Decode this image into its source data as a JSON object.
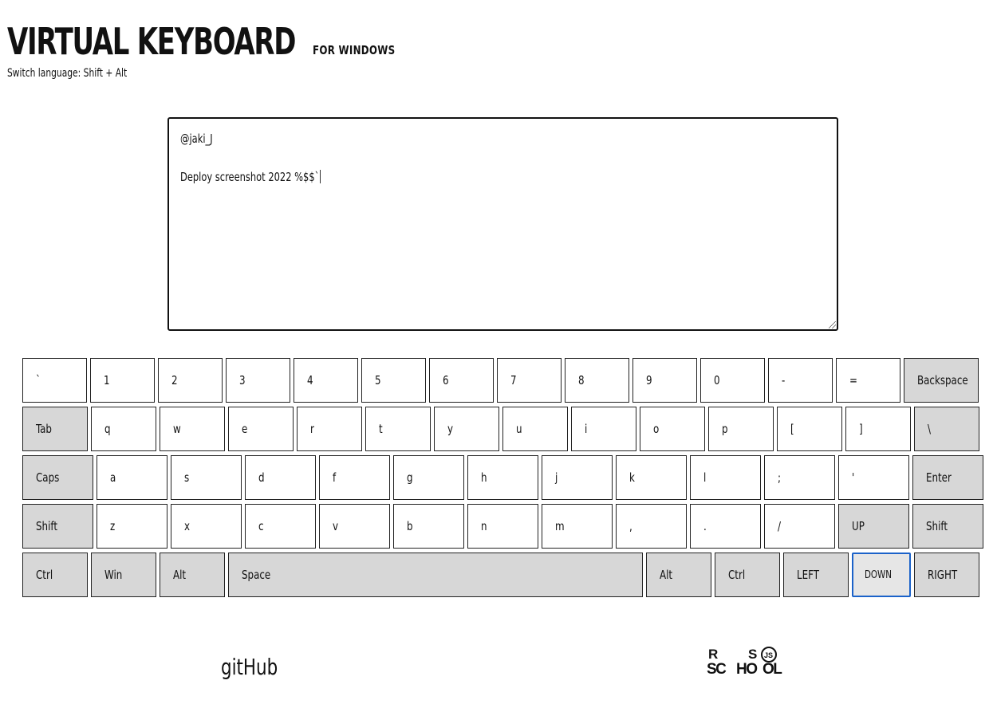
{
  "header": {
    "title": "VIRTUAL KEYBOARD",
    "subtitle": "FOR WINDOWS",
    "hint": "Switch language: Shift + Alt"
  },
  "editor": {
    "lines": [
      "@jaki_J",
      "",
      "Deploy screenshot 2022 %$$`"
    ]
  },
  "keyboard": {
    "rows": [
      [
        {
          "label": "`",
          "w": 81
        },
        {
          "label": "1",
          "w": 81
        },
        {
          "label": "2",
          "w": 81
        },
        {
          "label": "3",
          "w": 81
        },
        {
          "label": "4",
          "w": 81
        },
        {
          "label": "5",
          "w": 81
        },
        {
          "label": "6",
          "w": 81
        },
        {
          "label": "7",
          "w": 81
        },
        {
          "label": "8",
          "w": 81
        },
        {
          "label": "9",
          "w": 81
        },
        {
          "label": "0",
          "w": 81
        },
        {
          "label": "-",
          "w": 81
        },
        {
          "label": "=",
          "w": 81
        },
        {
          "label": "Backspace",
          "w": 94,
          "special": true
        }
      ],
      [
        {
          "label": "Tab",
          "w": 82,
          "special": true
        },
        {
          "label": "q",
          "w": 82
        },
        {
          "label": "w",
          "w": 82
        },
        {
          "label": "e",
          "w": 82
        },
        {
          "label": "r",
          "w": 82
        },
        {
          "label": "t",
          "w": 82
        },
        {
          "label": "y",
          "w": 82
        },
        {
          "label": "u",
          "w": 82
        },
        {
          "label": "i",
          "w": 82
        },
        {
          "label": "o",
          "w": 82
        },
        {
          "label": "p",
          "w": 82
        },
        {
          "label": "[",
          "w": 82
        },
        {
          "label": "]",
          "w": 82
        },
        {
          "label": "\\",
          "w": 82,
          "special": true
        }
      ],
      [
        {
          "label": "Caps",
          "w": 89,
          "special": true
        },
        {
          "label": "a",
          "w": 89
        },
        {
          "label": "s",
          "w": 89
        },
        {
          "label": "d",
          "w": 89
        },
        {
          "label": "f",
          "w": 89
        },
        {
          "label": "g",
          "w": 89
        },
        {
          "label": "h",
          "w": 89
        },
        {
          "label": "j",
          "w": 89
        },
        {
          "label": "k",
          "w": 89
        },
        {
          "label": "l",
          "w": 89
        },
        {
          "label": ";",
          "w": 89
        },
        {
          "label": "'",
          "w": 89
        },
        {
          "label": "Enter",
          "w": 89,
          "special": true
        }
      ],
      [
        {
          "label": "Shift",
          "w": 89,
          "special": true
        },
        {
          "label": "z",
          "w": 89
        },
        {
          "label": "x",
          "w": 89
        },
        {
          "label": "c",
          "w": 89
        },
        {
          "label": "v",
          "w": 89
        },
        {
          "label": "b",
          "w": 89
        },
        {
          "label": "n",
          "w": 89
        },
        {
          "label": "m",
          "w": 89
        },
        {
          "label": ",",
          "w": 89
        },
        {
          "label": ".",
          "w": 89
        },
        {
          "label": "/",
          "w": 89
        },
        {
          "label": "UP",
          "w": 89,
          "special": true
        },
        {
          "label": "Shift",
          "w": 89,
          "special": true
        }
      ],
      [
        {
          "label": "Ctrl",
          "w": 82,
          "special": true
        },
        {
          "label": "Win",
          "w": 82,
          "special": true
        },
        {
          "label": "Alt",
          "w": 82,
          "special": true
        },
        {
          "label": "Space",
          "w": 520,
          "special": true
        },
        {
          "label": "Alt",
          "w": 82,
          "special": true
        },
        {
          "label": "Ctrl",
          "w": 82,
          "special": true
        },
        {
          "label": "LEFT",
          "w": 82,
          "special": true
        },
        {
          "label": "DOWN",
          "w": 74,
          "special": true,
          "active": true
        },
        {
          "label": "RIGHT",
          "w": 82,
          "special": true
        }
      ]
    ]
  },
  "footer": {
    "github_label": "gitHub",
    "logo_text": [
      "R",
      "S",
      "SC",
      "HO",
      "OL",
      "JS"
    ]
  }
}
